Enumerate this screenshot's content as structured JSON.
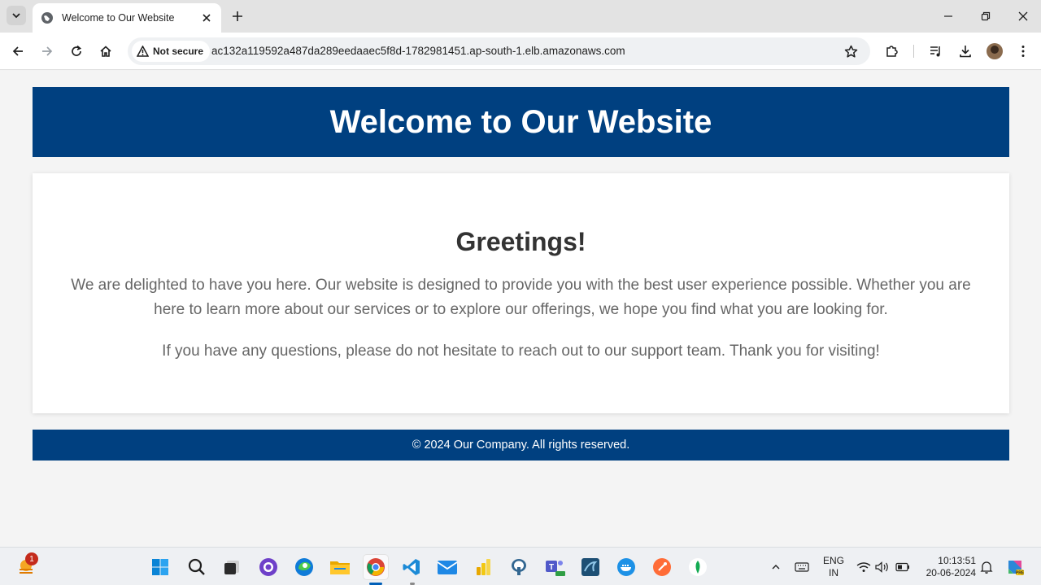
{
  "browser": {
    "tab_title": "Welcome to Our Website",
    "security_label": "Not secure",
    "url": "ac132a119592a487da289eedaaec5f8d-1782981451.ap-south-1.elb.amazonaws.com"
  },
  "page": {
    "header_title": "Welcome to Our Website",
    "greeting": "Greetings!",
    "paragraph1": "We are delighted to have you here. Our website is designed to provide you with the best user experience possible. Whether you are here to learn more about our services or to explore our offerings, we hope you find what you are looking for.",
    "paragraph2": "If you have any questions, please do not hesitate to reach out to our support team. Thank you for visiting!",
    "footer": "© 2024 Our Company. All rights reserved.",
    "colors": {
      "header_bg": "#004080",
      "footer_bg": "#004080"
    }
  },
  "taskbar": {
    "weather_badge": "1",
    "apps": [
      "windows-start",
      "search",
      "task-view",
      "github-desktop",
      "edge",
      "file-explorer",
      "chrome",
      "vs-code",
      "mail",
      "power-bi",
      "postgresql",
      "teams",
      "mysql-workbench",
      "docker",
      "postman",
      "mongodb-compass"
    ],
    "lang_line1": "ENG",
    "lang_line2": "IN",
    "time": "10:13:51",
    "date": "20-06-2024"
  }
}
